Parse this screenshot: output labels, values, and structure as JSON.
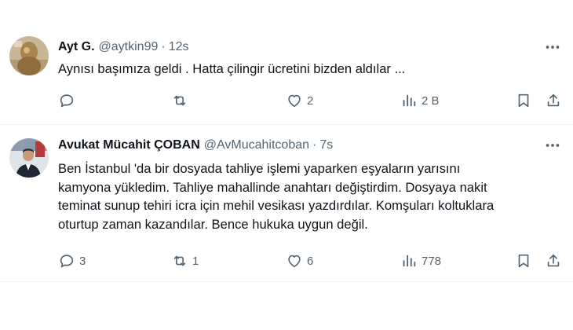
{
  "tweets": [
    {
      "display_name": "Ayt G.",
      "handle": "@aytkin99",
      "separator": "·",
      "time": "12s",
      "text": "Aynısı başımıza geldi . Hatta çilingir ücretini bizden aldılar ...",
      "replies": "",
      "retweets": "",
      "likes": "2",
      "views": "2 B",
      "icons": {
        "avatar": "statue-avatar",
        "more": "more-icon",
        "reply": "reply-icon",
        "retweet": "retweet-icon",
        "like": "heart-icon",
        "views": "views-icon",
        "bookmark": "bookmark-icon",
        "share": "share-icon"
      }
    },
    {
      "display_name": "Avukat Mücahit ÇOBAN",
      "handle": "@AvMucahitcoban",
      "separator": "·",
      "time": "7s",
      "text_lines": [
        "Ben İstanbul 'da bir dosyada tahliye işlemi yaparken eşyaların yarısını",
        "kamyona yükledim. Tahliye mahallinde anahtarı değiştirdim. Dosyaya nakit",
        "teminat sunup tehiri icra için mehil vesikası yazdırdılar. Komşuları koltuklara",
        "oturtup zaman kazandılar. Bence hukuka uygun değil."
      ],
      "replies": "3",
      "retweets": "1",
      "likes": "6",
      "views": "778"
    }
  ],
  "colors": {
    "text": "#0f1419",
    "secondary": "#536471",
    "divider": "#eff3f4"
  }
}
